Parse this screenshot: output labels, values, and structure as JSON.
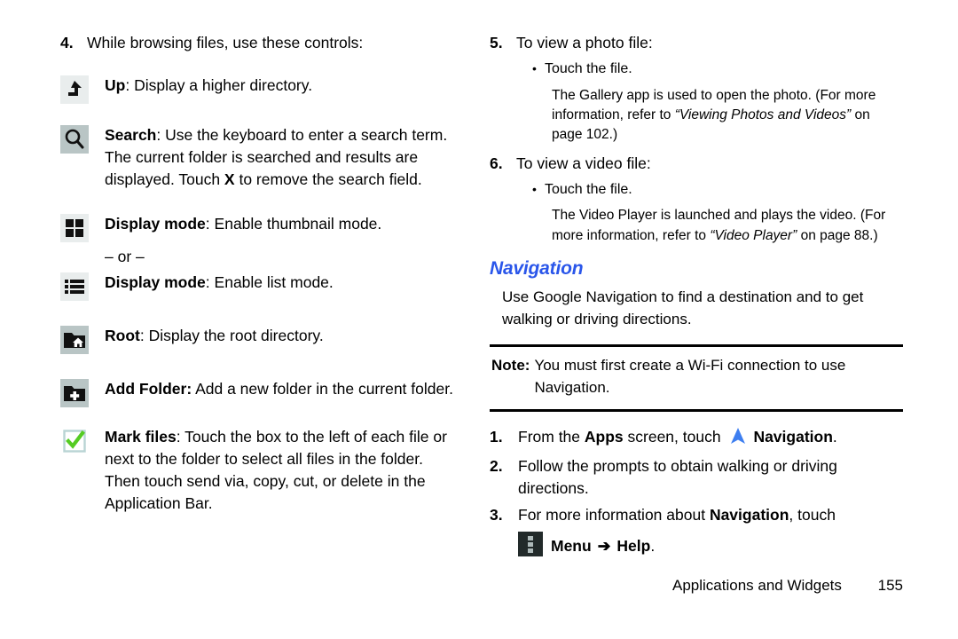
{
  "left_column": {
    "step": {
      "number": "4.",
      "text": "While browsing files, use these controls:"
    },
    "controls": [
      {
        "icon": "up-arrow-icon",
        "label": "Up",
        "separator": ":",
        "description": " Display a higher directory."
      },
      {
        "icon": "search-icon",
        "label": "Search",
        "separator": ":",
        "description": " Use the keyboard to enter a search term. The current folder is searched and results are displayed. Touch ",
        "description_bold": "X",
        "description_tail": " to remove the search field."
      },
      {
        "icon": "grid-view-icon",
        "label": "Display mode",
        "separator": ":",
        "description": " Enable thumbnail mode."
      },
      {
        "icon": "list-view-icon",
        "label": "Display mode",
        "separator": ":",
        "description": " Enable list mode."
      },
      {
        "icon": "folder-home-icon",
        "label": "Root",
        "separator": ":",
        "description": " Display the root directory."
      },
      {
        "icon": "folder-plus-icon",
        "label": "Add Folder:",
        "separator": "",
        "description": " Add a new folder in the current folder."
      },
      {
        "icon": "green-check-icon",
        "label": "Mark files",
        "separator": ":",
        "description": " Touch the box to the left of each file or next to the folder to select all files in the folder. Then touch send via, copy, cut, or delete in the Application Bar."
      }
    ],
    "or_separator": "– or –"
  },
  "right_column": {
    "steps": [
      {
        "number": "5.",
        "text": "To view a photo file:",
        "bullet": "Touch the file.",
        "note_pre": "The Gallery app is used to open the photo. (For more information, refer to ",
        "note_italic": "“Viewing Photos and Videos”",
        "note_post": " on page 102.)"
      },
      {
        "number": "6.",
        "text": "To view a video file:",
        "bullet": "Touch the file.",
        "note_pre": "The Video Player is launched and plays the video. (For more information, refer to ",
        "note_italic": "“Video Player”",
        "note_post": " on page 88.)"
      }
    ],
    "bullet_glyph": "•",
    "heading": "Navigation",
    "heading_color": "#2a56ea",
    "intro": "Use Google Navigation to find a destination and to get walking or driving directions.",
    "note": {
      "label": "Note:",
      "text": "You must first create a Wi-Fi connection to use Navigation."
    },
    "nav_steps": [
      {
        "number": "1.",
        "pre": "From the ",
        "bold1": "Apps",
        "mid": " screen, touch ",
        "icon": "navigation-arrow-icon",
        "bold2": "Navigation",
        "post": "."
      },
      {
        "number": "2.",
        "pre": "Follow the prompts to obtain walking or driving directions.",
        "bold1": "",
        "mid": "",
        "icon": "",
        "bold2": "",
        "post": ""
      },
      {
        "number": "3.",
        "pre": "For more information about ",
        "bold1": "Navigation",
        "mid": ", touch",
        "icon": "",
        "bold2": "",
        "post": ""
      }
    ],
    "menu_line": {
      "icon": "overflow-menu-icon",
      "menu_label": "Menu",
      "arrow": "➔",
      "help_label": "Help",
      "period": "."
    }
  },
  "footer": {
    "title": "Applications and Widgets",
    "page": "155"
  }
}
